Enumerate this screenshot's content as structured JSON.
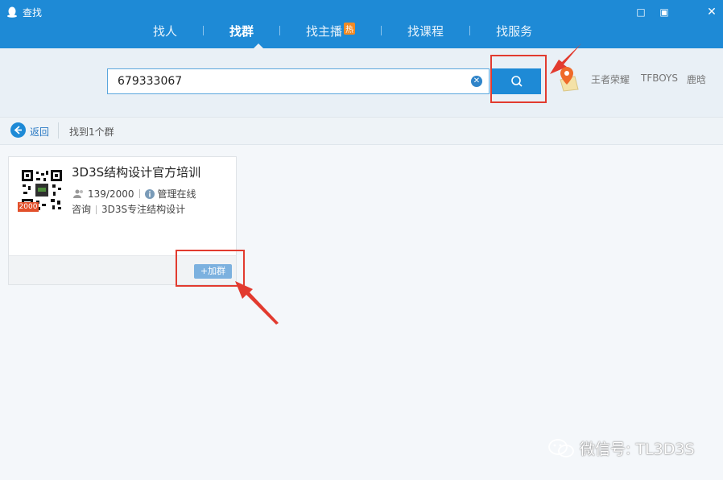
{
  "window": {
    "title": "查找"
  },
  "tabs": [
    {
      "label": "找人"
    },
    {
      "label": "找群"
    },
    {
      "label": "找主播",
      "badge": "热"
    },
    {
      "label": "找课程"
    },
    {
      "label": "找服务"
    }
  ],
  "active_tab": "找群",
  "search": {
    "value": "679333067"
  },
  "hot_searches": [
    "王者荣耀",
    "TFBOYS",
    "鹿晗"
  ],
  "nav": {
    "back_label": "返回",
    "result_text": "找到1个群"
  },
  "group": {
    "name": "3D3S结构设计官方培训",
    "capacity_badge": "2000",
    "members": "139/2000",
    "admin_status": "管理在线",
    "category": "咨询",
    "tag": "3D3S专注结构设计",
    "join_label": "+加群"
  },
  "watermark": {
    "text": "微信号: TL3D3S"
  },
  "colors": {
    "titlebar": "#1e8ad6",
    "highlight": "#e23b2f",
    "join_button": "#7cb1df"
  }
}
